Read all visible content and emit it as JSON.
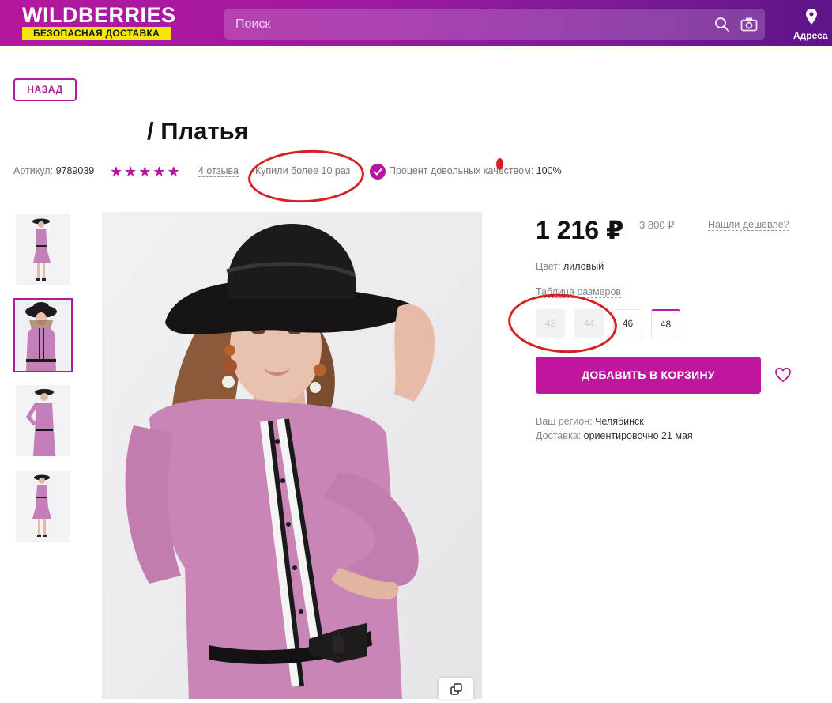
{
  "header": {
    "logo": "WILDBERRIES",
    "logo_badge": "БЕЗОПАСНАЯ ДОСТАВКА",
    "search_placeholder": "Поиск",
    "addresses_label": "Адреса"
  },
  "nav": {
    "back_label": "НАЗАД"
  },
  "product": {
    "title": "/ Платья",
    "article_label": "Артикул:",
    "article_value": "9789039",
    "rating_stars": 5,
    "reviews": "4 отзыва",
    "bought": "Купили более 10 раз",
    "satisfied_label": "Процент довольных качеством:",
    "satisfied_value": "100%"
  },
  "pricing": {
    "price": "1 216 ₽",
    "old_price": "3 800 ₽",
    "cheaper_link": "Нашли дешевле?"
  },
  "color": {
    "label": "Цвет:",
    "value": "лиловый"
  },
  "sizes": {
    "table_link": "Таблица размеров",
    "items": [
      {
        "label": "42",
        "available": false
      },
      {
        "label": "44",
        "available": false
      },
      {
        "label": "46",
        "available": true
      },
      {
        "label": "48",
        "available": true,
        "selected": true
      }
    ]
  },
  "cart": {
    "add_label": "ДОБАВИТЬ В КОРЗИНУ"
  },
  "delivery": {
    "region_label": "Ваш регион:",
    "region_value": "Челябинск",
    "delivery_label": "Доставка:",
    "delivery_value": "ориентировочно 21 мая"
  },
  "colors": {
    "brand": "#b5179e",
    "cart_button": "#c0169d",
    "logo_badge": "#f5e60a",
    "annotation": "#d42222"
  },
  "icons": [
    "search-icon",
    "camera-icon",
    "location-pin-icon",
    "star-icon",
    "check-icon",
    "heart-icon",
    "compare-icon"
  ]
}
